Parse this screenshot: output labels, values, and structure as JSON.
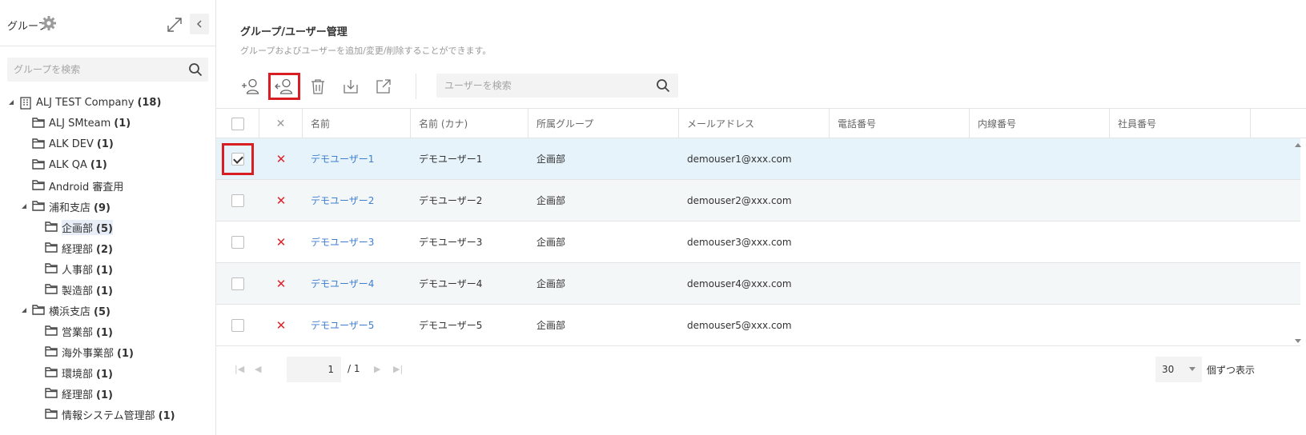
{
  "sidebar": {
    "title": "グループ",
    "search_placeholder": "グループを検索",
    "tree": [
      {
        "label": "ALJ TEST Company",
        "count": "(18)",
        "level": 0,
        "icon": "building-icon",
        "expanded": true
      },
      {
        "label": "ALJ SMteam",
        "count": "(1)",
        "level": 1,
        "icon": "folder-icon"
      },
      {
        "label": "ALK DEV",
        "count": "(1)",
        "level": 1,
        "icon": "folder-icon"
      },
      {
        "label": "ALK QA",
        "count": "(1)",
        "level": 1,
        "icon": "folder-icon"
      },
      {
        "label": "Android 審査用",
        "count": "",
        "level": 1,
        "icon": "folder-icon"
      },
      {
        "label": "浦和支店",
        "count": "(9)",
        "level": 1,
        "icon": "folder-icon",
        "expanded": true
      },
      {
        "label": "企画部",
        "count": "(5)",
        "level": 2,
        "icon": "folder-icon",
        "selected": true
      },
      {
        "label": "経理部",
        "count": "(2)",
        "level": 2,
        "icon": "folder-icon"
      },
      {
        "label": "人事部",
        "count": "(1)",
        "level": 2,
        "icon": "folder-icon"
      },
      {
        "label": "製造部",
        "count": "(1)",
        "level": 2,
        "icon": "folder-icon"
      },
      {
        "label": "横浜支店",
        "count": "(5)",
        "level": 1,
        "icon": "folder-icon",
        "expanded": true
      },
      {
        "label": "営業部",
        "count": "(1)",
        "level": 2,
        "icon": "folder-icon"
      },
      {
        "label": "海外事業部",
        "count": "(1)",
        "level": 2,
        "icon": "folder-icon"
      },
      {
        "label": "環境部",
        "count": "(1)",
        "level": 2,
        "icon": "folder-icon"
      },
      {
        "label": "経理部",
        "count": "(1)",
        "level": 2,
        "icon": "folder-icon"
      },
      {
        "label": "情報システム管理部",
        "count": "(1)",
        "level": 2,
        "icon": "folder-icon"
      }
    ]
  },
  "main": {
    "title": "グループ/ユーザー管理",
    "description": "グループおよびユーザーを追加/変更/削除することができます。",
    "toolbar": {
      "buttons": [
        {
          "name": "add-user-button",
          "icon": "add-user-icon"
        },
        {
          "name": "move-user-button",
          "icon": "move-user-icon"
        },
        {
          "name": "delete-button",
          "icon": "trash-icon"
        },
        {
          "name": "import-button",
          "icon": "download-icon"
        },
        {
          "name": "export-button",
          "icon": "external-link-icon"
        }
      ],
      "search_placeholder": "ユーザーを検索"
    },
    "table": {
      "columns": [
        "",
        "✕",
        "名前",
        "名前 (カナ)",
        "所属グループ",
        "メールアドレス",
        "電話番号",
        "内線番号",
        "社員番号"
      ],
      "rows": [
        {
          "checked": true,
          "name": "デモユーザー1",
          "kana": "デモユーザー1",
          "group": "企画部",
          "email": "demouser1@xxx.com",
          "phone": "",
          "ext": "",
          "employee_no": ""
        },
        {
          "checked": false,
          "name": "デモユーザー2",
          "kana": "デモユーザー2",
          "group": "企画部",
          "email": "demouser2@xxx.com",
          "phone": "",
          "ext": "",
          "employee_no": ""
        },
        {
          "checked": false,
          "name": "デモユーザー3",
          "kana": "デモユーザー3",
          "group": "企画部",
          "email": "demouser3@xxx.com",
          "phone": "",
          "ext": "",
          "employee_no": ""
        },
        {
          "checked": false,
          "name": "デモユーザー4",
          "kana": "デモユーザー4",
          "group": "企画部",
          "email": "demouser4@xxx.com",
          "phone": "",
          "ext": "",
          "employee_no": ""
        },
        {
          "checked": false,
          "name": "デモユーザー5",
          "kana": "デモユーザー5",
          "group": "企画部",
          "email": "demouser5@xxx.com",
          "phone": "",
          "ext": "",
          "employee_no": ""
        }
      ]
    },
    "pager": {
      "page": "1",
      "total": "/ 1",
      "page_size": "30",
      "page_size_unit": "個ずつ表示"
    }
  },
  "colors": {
    "link": "#3f7fd1",
    "delete": "#e0202a",
    "highlight": "#d81e23",
    "selected_row": "#e6f3fb"
  }
}
